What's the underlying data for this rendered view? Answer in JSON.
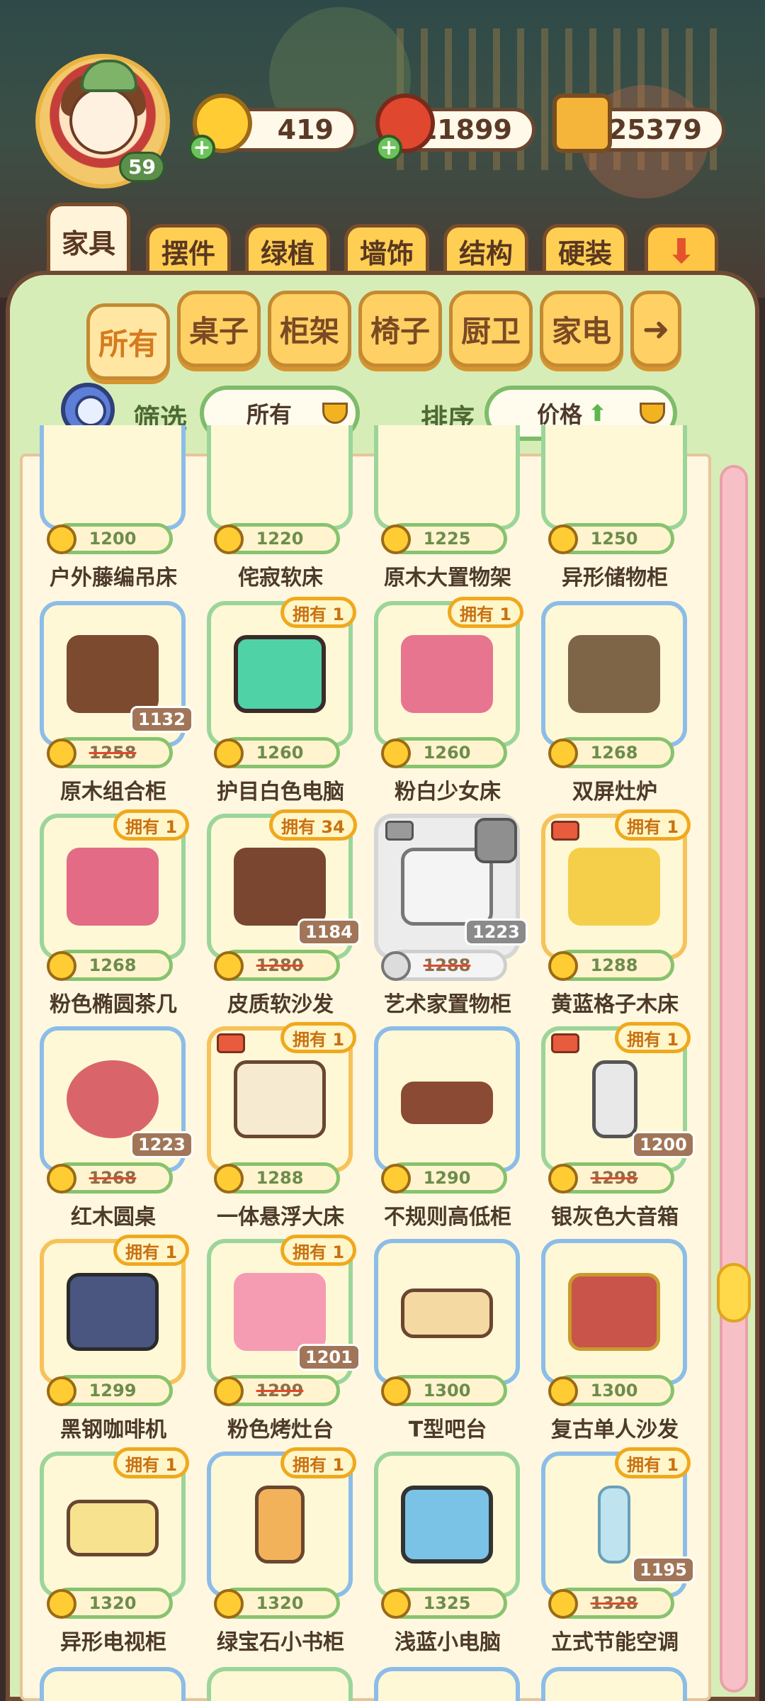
{
  "currencies": {
    "coins": "419",
    "peppers": "11899",
    "tickets": "25379"
  },
  "player": {
    "level": "59"
  },
  "category_tabs": [
    {
      "label": "家具",
      "active": true
    },
    {
      "label": "摆件"
    },
    {
      "label": "绿植"
    },
    {
      "label": "墙饰"
    },
    {
      "label": "结构"
    },
    {
      "label": "硬装"
    }
  ],
  "sub_tabs": [
    {
      "label": "所有",
      "active": true
    },
    {
      "label": "桌子"
    },
    {
      "label": "柜架"
    },
    {
      "label": "椅子"
    },
    {
      "label": "厨卫"
    },
    {
      "label": "家电"
    }
  ],
  "filter": {
    "label": "筛选",
    "value": "所有"
  },
  "sort": {
    "label": "排序",
    "value": "价格"
  },
  "items": [
    {
      "name": "户外藤编吊床",
      "price": "1200"
    },
    {
      "name": "侘寂软床",
      "price": "1220"
    },
    {
      "name": "原木大置物架",
      "price": "1225"
    },
    {
      "name": "异形储物柜",
      "price": "1250"
    },
    {
      "name": "原木组合柜",
      "price": "1258",
      "discount": "1132"
    },
    {
      "name": "护目白色电脑",
      "price": "1260",
      "owned": "拥有 1"
    },
    {
      "name": "粉白少女床",
      "price": "1260",
      "owned": "拥有 1"
    },
    {
      "name": "双屏灶炉",
      "price": "1268"
    },
    {
      "name": "粉色椭圆茶几",
      "price": "1268",
      "owned": "拥有 1"
    },
    {
      "name": "皮质软沙发",
      "price": "1280",
      "owned": "拥有 34",
      "discount": "1184"
    },
    {
      "name": "艺术家置物柜",
      "price": "1288",
      "discount": "1223"
    },
    {
      "name": "黄蓝格子木床",
      "price": "1288",
      "owned": "拥有 1"
    },
    {
      "name": "红木圆桌",
      "price": "1268",
      "discount": "1223"
    },
    {
      "name": "一体悬浮大床",
      "price": "1288",
      "owned": "拥有 1"
    },
    {
      "name": "不规则高低柜",
      "price": "1290"
    },
    {
      "name": "银灰色大音箱",
      "price": "1298",
      "owned": "拥有 1",
      "discount": "1200"
    },
    {
      "name": "黑钢咖啡机",
      "price": "1299",
      "owned": "拥有 1"
    },
    {
      "name": "粉色烤灶台",
      "price": "1299",
      "owned": "拥有 1",
      "discount": "1201"
    },
    {
      "name": "T型吧台",
      "price": "1300"
    },
    {
      "name": "复古单人沙发",
      "price": "1300"
    },
    {
      "name": "异形电视柜",
      "price": "1320",
      "owned": "拥有 1"
    },
    {
      "name": "绿宝石小书柜",
      "price": "1320",
      "owned": "拥有 1"
    },
    {
      "name": "浅蓝小电脑",
      "price": "1325"
    },
    {
      "name": "立式节能空调",
      "price": "1328",
      "owned": "拥有 1",
      "discount": "1195"
    }
  ],
  "colors": {
    "panel": "#d7edb8",
    "tab": "#ffcf54",
    "price_border": "#87c36e",
    "owned_border": "#f0a81d"
  },
  "icons": [
    "coin-icon",
    "pepper-icon",
    "ticket-icon",
    "plus-icon",
    "search-icon",
    "dropdown-icon",
    "arrow-down-icon",
    "arrow-right-icon",
    "truck-icon",
    "lock-icon"
  ]
}
